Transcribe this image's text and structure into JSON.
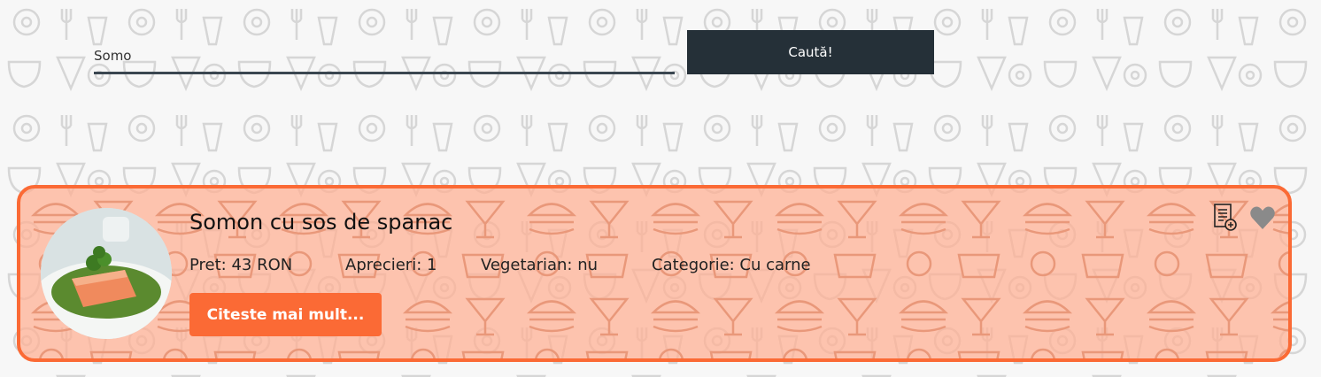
{
  "search": {
    "value": "Somo",
    "button_label": "Caută!"
  },
  "result": {
    "title": "Somon cu sos de spanac",
    "price": "Pret: 43 RON",
    "likes": "Aprecieri: 1",
    "vegetarian": "Vegetarian: nu",
    "category": "Categorie: Cu carne",
    "read_more_label": "Citeste mai mult...",
    "image_icon": "salmon-dish-photo",
    "actions": [
      "add-to-list-icon",
      "heart-icon"
    ]
  },
  "colors": {
    "accent": "#fb6a35",
    "card_fill": "#ffb093",
    "dark_button": "#253038",
    "heart": "#8a8a8a"
  }
}
